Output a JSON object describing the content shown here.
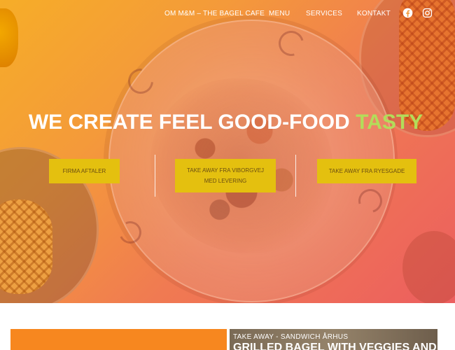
{
  "nav": {
    "items": [
      {
        "label": "OM M&M – THE BAGEL CAFE"
      },
      {
        "label": "MENU"
      },
      {
        "label": "SERVICES"
      },
      {
        "label": "KONTAKT"
      }
    ],
    "social": [
      "facebook-icon",
      "instagram-icon"
    ]
  },
  "hero": {
    "headline_main": "WE CREATE FEEL GOOD-FOOD ",
    "headline_accent": "TASTY",
    "buttons": [
      {
        "label": "FIRMA AFTALER"
      },
      {
        "label": "TAKE AWAY FRA VIBORGVEJ MED LEVERING"
      },
      {
        "label": "TAKE AWAY FRA RYESGADE"
      }
    ]
  },
  "promo": {
    "kicker": "TAKE AWAY - SANDWICH ÅRHUS",
    "title": "GRILLED BAGEL WITH VEGGIES AND"
  },
  "colors": {
    "hero_gradient_start": "#f6ad28",
    "hero_gradient_end": "#ec5e5f",
    "accent_green": "#b3dc5a",
    "button_yellow": "#e4c00f",
    "button_text": "#6b4e12",
    "orange_box": "#f7871f"
  }
}
